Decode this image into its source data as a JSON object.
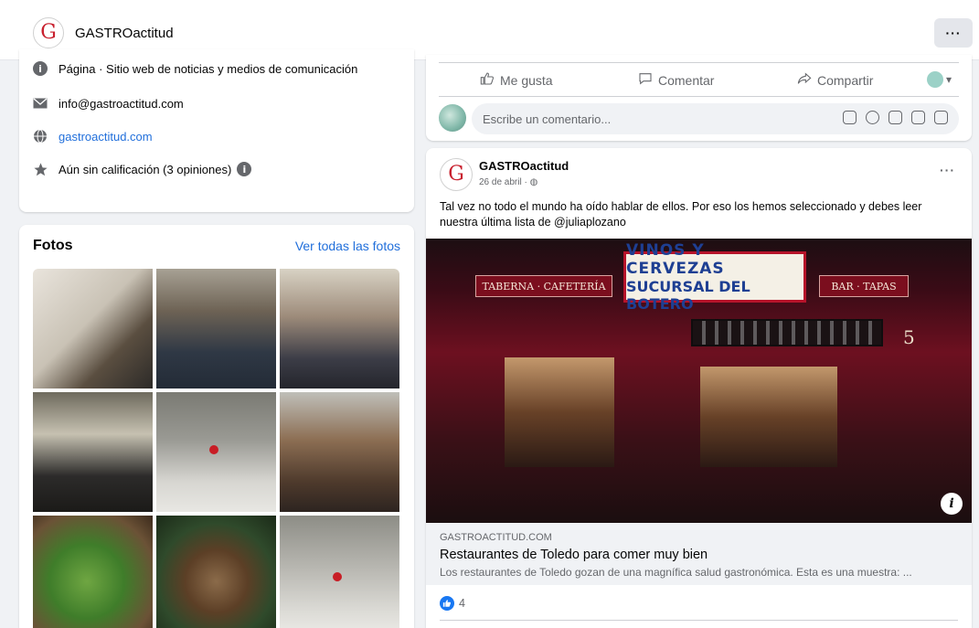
{
  "header": {
    "logo_letter": "G",
    "page_name": "GASTROactitud",
    "more_label": "···"
  },
  "intro": {
    "category": "Página · Sitio web de noticias y medios de comunicación",
    "email": "info@gastroactitud.com",
    "website": "gastroactitud.com",
    "rating": "Aún sin calificación (3 opiniones)",
    "info_glyph": "i"
  },
  "photos": {
    "title": "Fotos",
    "see_all": "Ver todas las fotos"
  },
  "actions": {
    "like": "Me gusta",
    "comment": "Comentar",
    "share": "Compartir",
    "comment_placeholder": "Escribe un comentario..."
  },
  "post": {
    "author": "GASTROactitud",
    "date": "26 de abril ·",
    "more": "···",
    "text": "Tal vez no todo el mundo ha oído hablar de ellos. Por eso los hemos seleccionado y debes leer nuestra última lista de @juliaplozano",
    "image_sign_line1": "VINOS Y CERVEZAS",
    "image_sign_line2": "SUCURSAL DEL BOTERO",
    "image_sign_left": "TABERNA · CAFETERÍA",
    "image_sign_right": "BAR · TAPAS",
    "image_door_number": "5",
    "info_glyph": "i",
    "link_domain": "GASTROACTITUD.COM",
    "link_title": "Restaurantes de Toledo para comer muy bien",
    "link_description": "Los restaurantes de Toledo gozan de una magnífica salud gastronómica. Esta es una muestra: ...",
    "reaction_count": "4"
  },
  "colors": {
    "accent_link": "#216fdb",
    "brand_red": "#c8202e",
    "like_blue": "#1877f2"
  }
}
